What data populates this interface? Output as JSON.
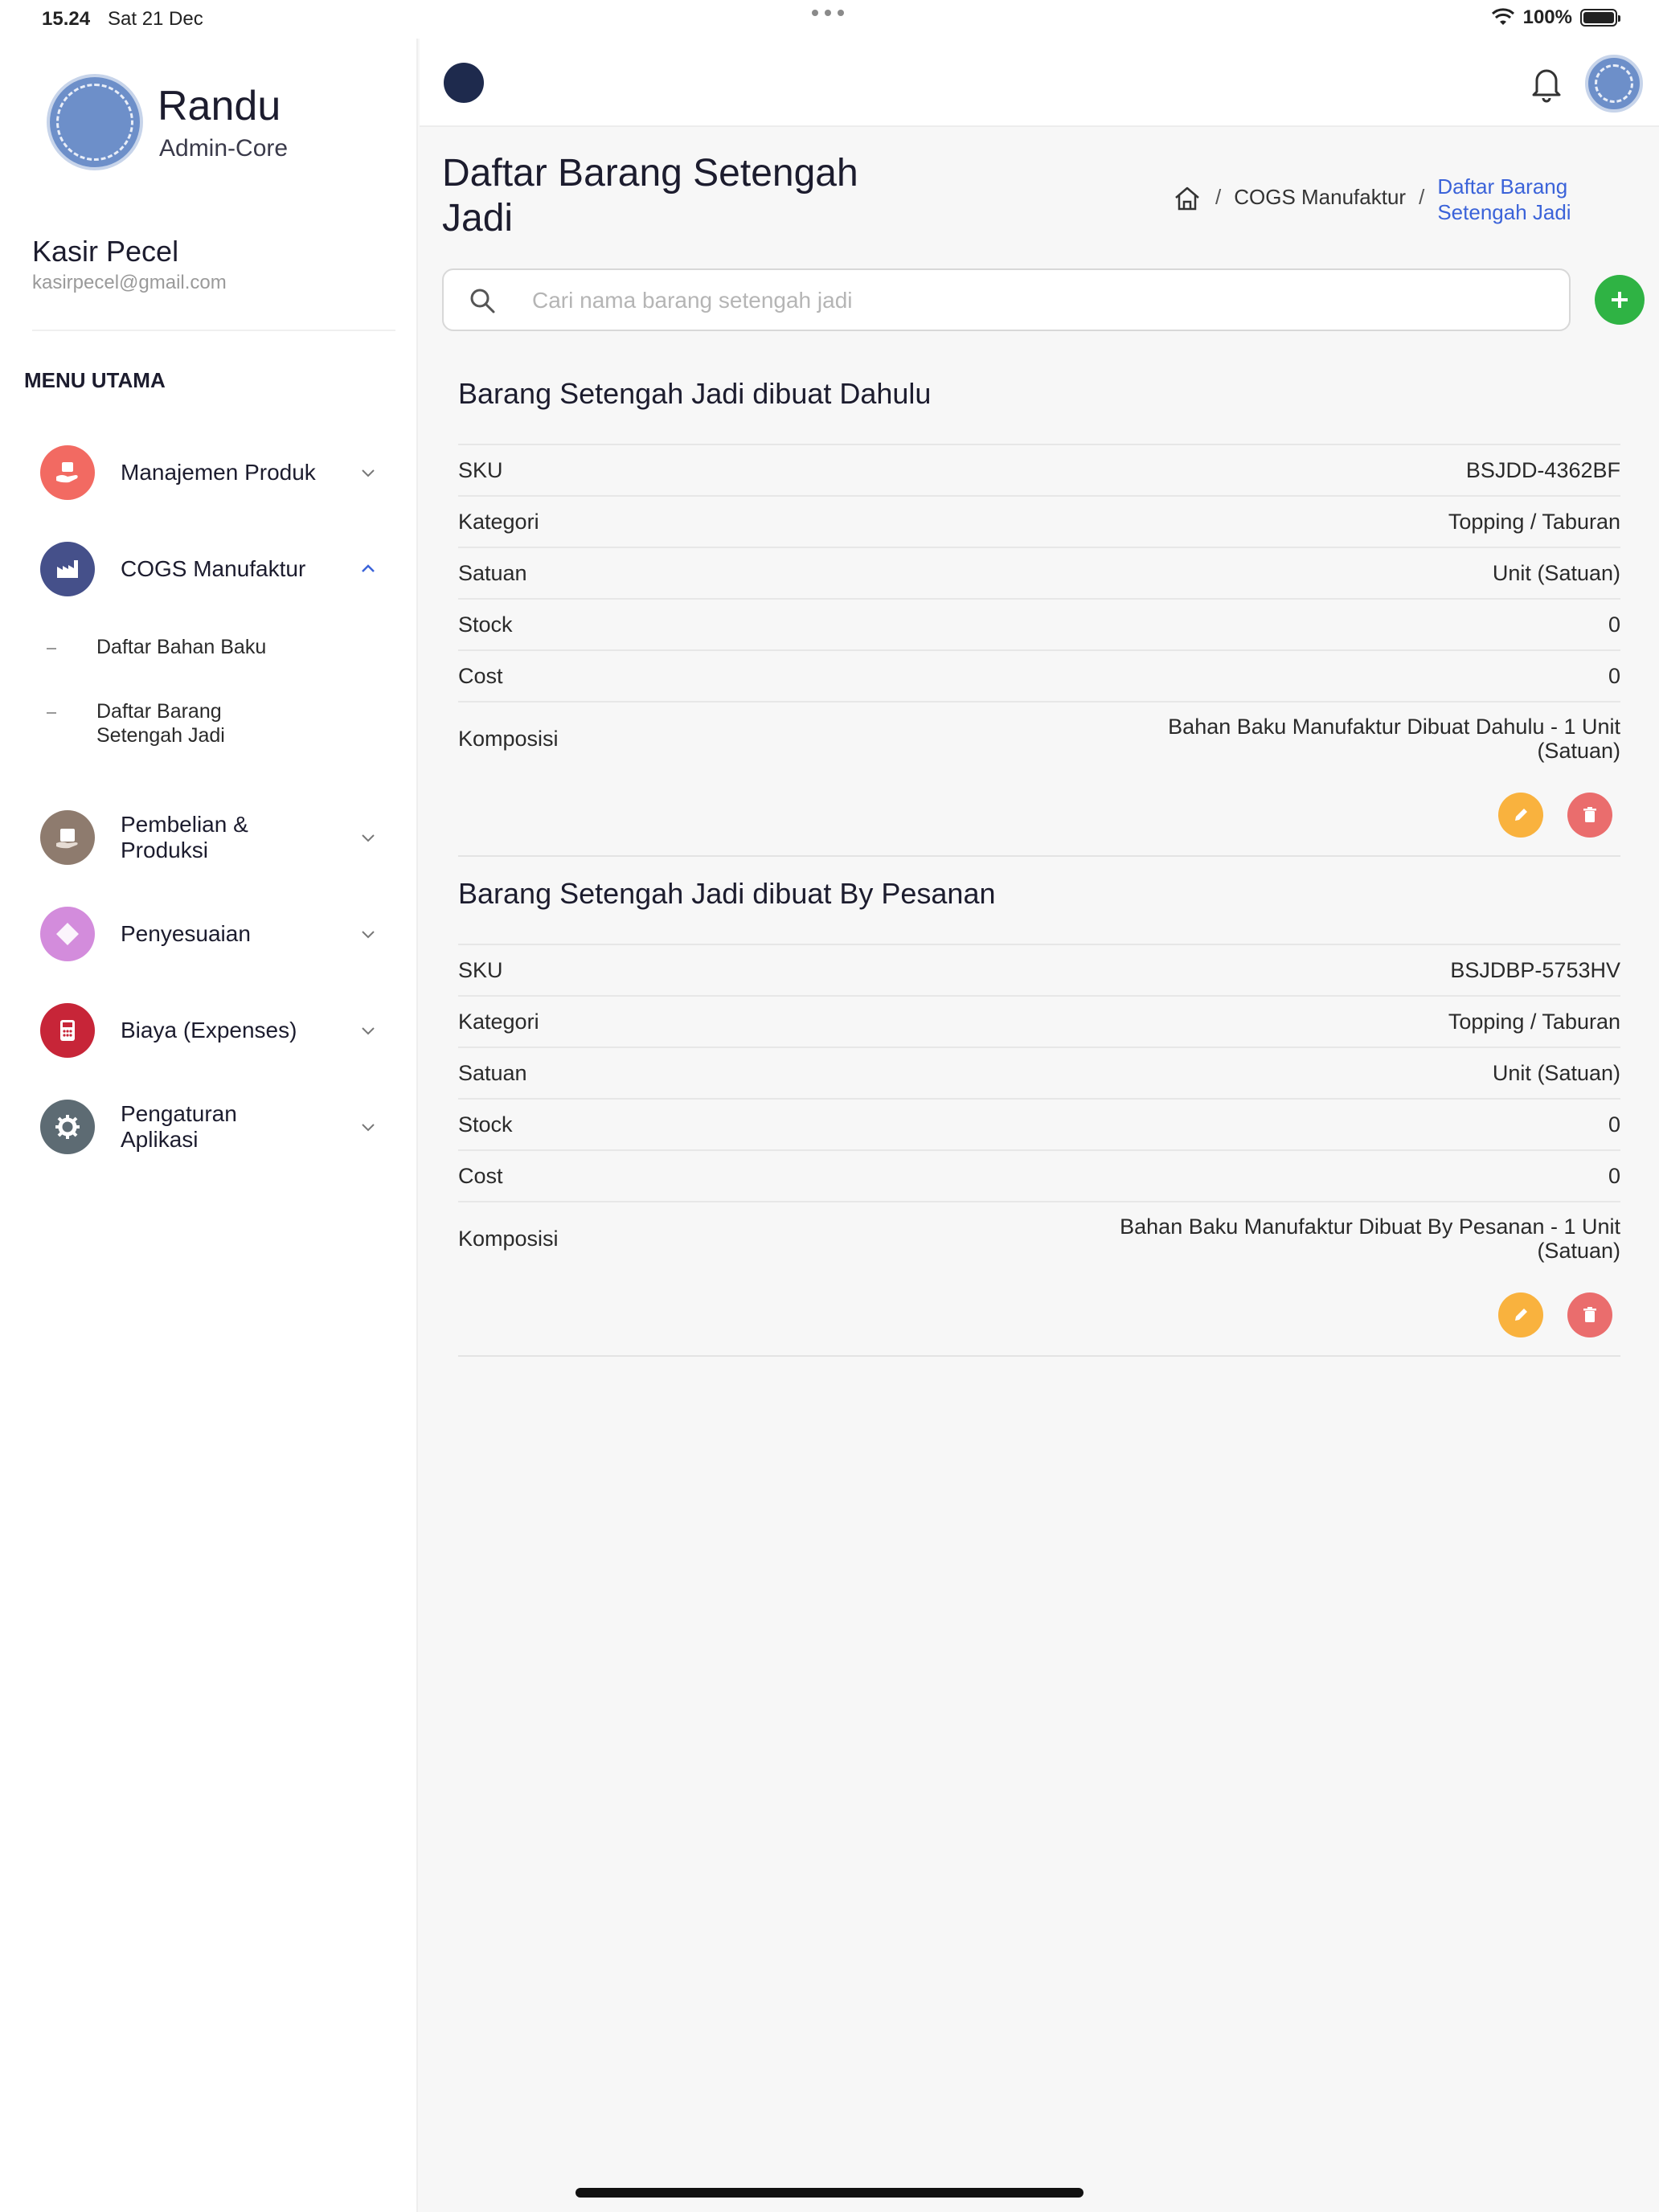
{
  "status_bar": {
    "time": "15.24",
    "date": "Sat 21 Dec",
    "battery": "100%"
  },
  "sidebar": {
    "brand_name": "Randu",
    "brand_sub": "Admin-Core",
    "user_name": "Kasir Pecel",
    "user_email": "kasirpecel@gmail.com",
    "menu_heading": "MENU UTAMA",
    "items": [
      {
        "label": "Manajemen Produk",
        "icon": "box-hand-icon",
        "color": "#f26a62",
        "expanded": false
      },
      {
        "label": "COGS Manufaktur",
        "icon": "factory-icon",
        "color": "#45508a",
        "expanded": true
      },
      {
        "label": "Pembelian & Produksi",
        "icon": "package-icon",
        "color": "#8e7b6e",
        "expanded": false
      },
      {
        "label": "Penyesuaian",
        "icon": "adjust-icon",
        "color": "#d38cdc",
        "expanded": false
      },
      {
        "label": "Biaya (Expenses)",
        "icon": "calculator-icon",
        "color": "#c72538",
        "expanded": false
      },
      {
        "label": "Pengaturan Aplikasi",
        "icon": "gear-icon",
        "color": "#5d6b73",
        "expanded": false
      }
    ],
    "submenu": [
      {
        "label": "Daftar Bahan Baku"
      },
      {
        "label": "Daftar Barang Setengah Jadi"
      }
    ]
  },
  "header": {
    "page_title": "Daftar Barang Setengah Jadi",
    "breadcrumb": [
      "COGS Manufaktur",
      "Daftar Barang Setengah Jadi"
    ]
  },
  "search": {
    "placeholder": "Cari nama barang setengah jadi",
    "value": ""
  },
  "labels": {
    "sku": "SKU",
    "kategori": "Kategori",
    "satuan": "Satuan",
    "stock": "Stock",
    "cost": "Cost",
    "komposisi": "Komposisi"
  },
  "items": [
    {
      "title": "Barang Setengah Jadi dibuat Dahulu",
      "sku": "BSJDD-4362BF",
      "kategori": "Topping / Taburan",
      "satuan": "Unit (Satuan)",
      "stock": "0",
      "cost": "0",
      "komposisi": "Bahan Baku Manufaktur Dibuat Dahulu - 1 Unit (Satuan)"
    },
    {
      "title": "Barang Setengah Jadi dibuat By Pesanan",
      "sku": "BSJDBP-5753HV",
      "kategori": "Topping / Taburan",
      "satuan": "Unit (Satuan)",
      "stock": "0",
      "cost": "0",
      "komposisi": "Bahan Baku Manufaktur Dibuat By Pesanan - 1 Unit (Satuan)"
    }
  ],
  "colors": {
    "accent": "#3b63d9",
    "add": "#2fb344",
    "edit": "#f9b23e",
    "delete": "#ea6d6d",
    "navy": "#1e2a4d"
  }
}
